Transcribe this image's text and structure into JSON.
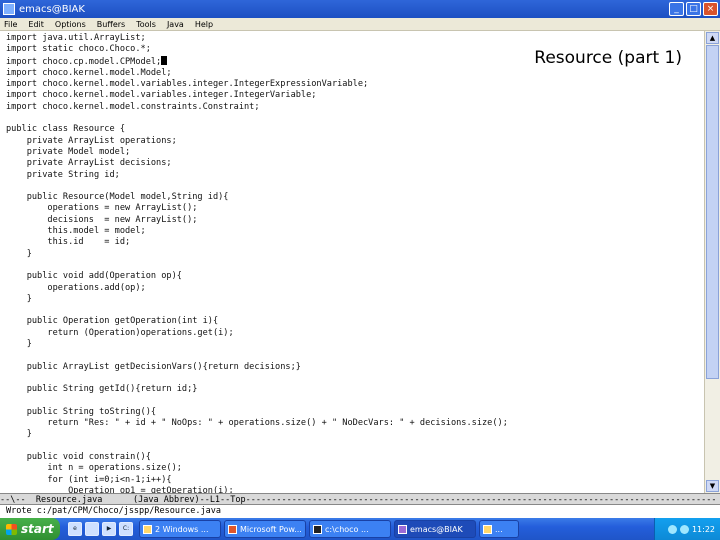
{
  "window": {
    "title": "emacs@BIAK",
    "buttons": {
      "minimize": "_",
      "maximize": "□",
      "close": "×"
    }
  },
  "menu": [
    "File",
    "Edit",
    "Options",
    "Buffers",
    "Tools",
    "Java",
    "Help"
  ],
  "slide_title": "Resource (part 1)",
  "code_lines": [
    "import java.util.ArrayList;",
    "import static choco.Choco.*;",
    "import choco.cp.model.CPModel;",
    "import choco.kernel.model.Model;",
    "import choco.kernel.model.variables.integer.IntegerExpressionVariable;",
    "import choco.kernel.model.variables.integer.IntegerVariable;",
    "import choco.kernel.model.constraints.Constraint;",
    "",
    "public class Resource {",
    "    private ArrayList operations;",
    "    private Model model;",
    "    private ArrayList decisions;",
    "    private String id;",
    "",
    "    public Resource(Model model,String id){",
    "        operations = new ArrayList();",
    "        decisions  = new ArrayList();",
    "        this.model = model;",
    "        this.id    = id;",
    "    }",
    "",
    "    public void add(Operation op){",
    "        operations.add(op);",
    "    }",
    "",
    "    public Operation getOperation(int i){",
    "        return (Operation)operations.get(i);",
    "    }",
    "",
    "    public ArrayList getDecisionVars(){return decisions;}",
    "",
    "    public String getId(){return id;}",
    "",
    "    public String toString(){",
    "        return \"Res: \" + id + \" NoOps: \" + operations.size() + \" NoDecVars: \" + decisions.size();",
    "    }",
    "",
    "    public void constrain(){",
    "        int n = operations.size();",
    "        for (int i=0;i<n-1;i++){",
    "            Operation op1 = getOperation(i);"
  ],
  "modeline": "--\\--  Resource.java      (Java Abbrev)--L1--Top--------------------------------------------------------------------------------------------",
  "minibuffer": "Wrote c:/pat/CPM/Choco/jsspp/Resource.java",
  "taskbar": {
    "start_label": "start",
    "quick_launch": [
      "ie-icon",
      "folder-icon",
      "media-icon",
      "cmd-icon"
    ],
    "tasks": [
      {
        "label": "2 Windows ...",
        "active": false
      },
      {
        "label": "Microsoft Pow...",
        "active": false
      },
      {
        "label": "c:\\choco ...",
        "active": false
      },
      {
        "label": "emacs@BIAK",
        "active": true
      },
      {
        "label": "...",
        "active": false
      }
    ],
    "clock": "11:22"
  }
}
